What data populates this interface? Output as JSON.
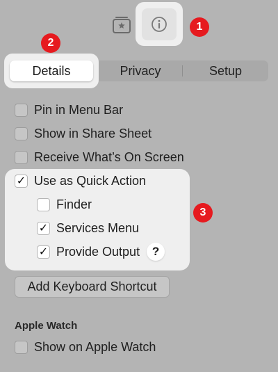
{
  "toolbar": {
    "add_icon": "square-stack-plus-icon",
    "info_icon": "info-circle-icon"
  },
  "badges": {
    "one": "1",
    "two": "2",
    "three": "3"
  },
  "tabs": {
    "details": "Details",
    "privacy": "Privacy",
    "setup": "Setup"
  },
  "options": {
    "pin_menu_bar": "Pin in Menu Bar",
    "share_sheet": "Show in Share Sheet",
    "receive_screen": "Receive What’s On Screen",
    "quick_action": "Use as Quick Action",
    "finder": "Finder",
    "services_menu": "Services Menu",
    "provide_output": "Provide Output",
    "help": "?"
  },
  "checks": {
    "pin_menu_bar": false,
    "share_sheet": false,
    "receive_screen": false,
    "quick_action": true,
    "finder": false,
    "services_menu": true,
    "provide_output": true,
    "apple_watch": false
  },
  "keyboard_shortcut_button": "Add Keyboard Shortcut",
  "apple_watch": {
    "heading": "Apple Watch",
    "option": "Show on Apple Watch"
  },
  "colors": {
    "background": "#b4b4b4",
    "highlight": "#efefef",
    "badge": "#e61a1f"
  }
}
